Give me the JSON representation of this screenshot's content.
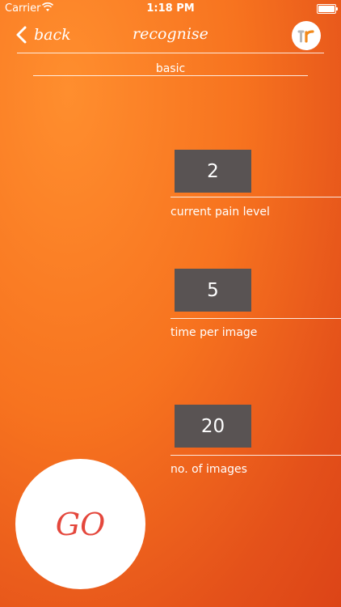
{
  "status_bar": {
    "carrier": "Carrier",
    "time": "1:18 PM"
  },
  "nav": {
    "back_label": "back",
    "title": "recognise",
    "logo_icon": "app-logo-icon"
  },
  "mode": {
    "label": "basic"
  },
  "settings": [
    {
      "value": "2",
      "label": "current pain level"
    },
    {
      "value": "5",
      "label": "time per image"
    },
    {
      "value": "20",
      "label": "no. of images"
    }
  ],
  "go_button": {
    "label": "GO",
    "color": "#e4473c"
  },
  "colors": {
    "background_top": "#ff8e2e",
    "background_bottom": "#dc4417",
    "box": "#595353"
  }
}
